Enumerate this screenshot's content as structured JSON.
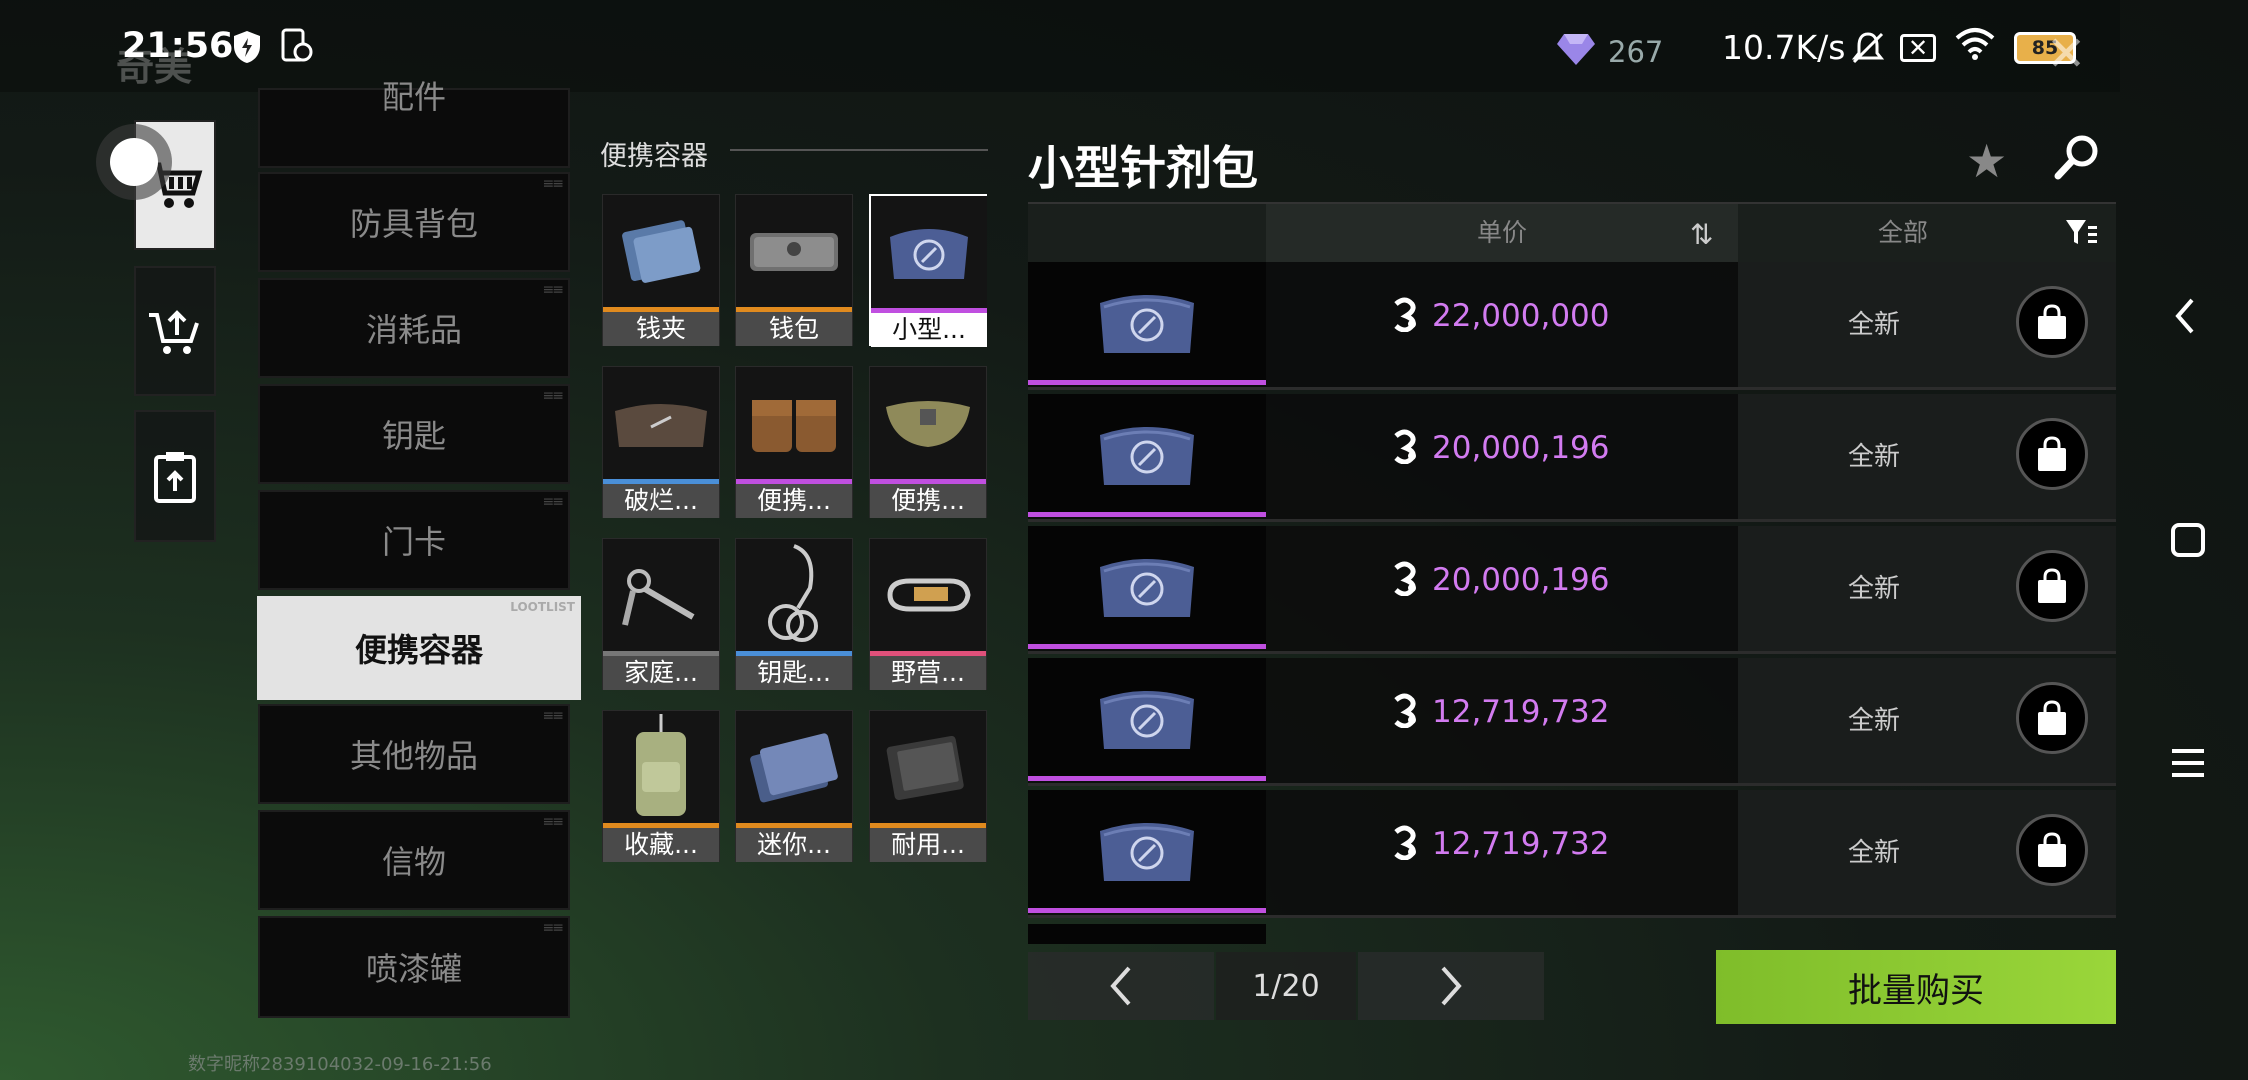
{
  "status_bar": {
    "time": "21:56",
    "gem_count": "267",
    "net_speed": "10.7K/s",
    "battery": "85"
  },
  "game_title": "奇美",
  "left_nav": [
    "market",
    "sell",
    "orders"
  ],
  "categories": {
    "partial_top": "配件",
    "items": [
      "防具背包",
      "消耗品",
      "钥匙",
      "门卡",
      "便携容器",
      "其他物品",
      "信物",
      "喷漆罐"
    ],
    "active": "便携容器",
    "active_tag": "LOOTLIST"
  },
  "grid": {
    "title": "便携容器",
    "items": [
      {
        "name": "钱夹",
        "rarity_color": "#e08a1e"
      },
      {
        "name": "钱包",
        "rarity_color": "#e08a1e"
      },
      {
        "name": "小型...",
        "rarity_color": "#c04fe0",
        "selected": true
      },
      {
        "name": "破烂...",
        "rarity_color": "#4a8fd8"
      },
      {
        "name": "便携...",
        "rarity_color": "#c04fe0"
      },
      {
        "name": "便携...",
        "rarity_color": "#c04fe0"
      },
      {
        "name": "家庭...",
        "rarity_color": "#777777"
      },
      {
        "name": "钥匙...",
        "rarity_color": "#4a8fd8"
      },
      {
        "name": "野营...",
        "rarity_color": "#e0507a"
      },
      {
        "name": "收藏...",
        "rarity_color": "#e08a1e"
      },
      {
        "name": "迷你...",
        "rarity_color": "#e08a1e"
      },
      {
        "name": "耐用...",
        "rarity_color": "#e08a1e"
      }
    ]
  },
  "panel": {
    "title": "小型针剂包",
    "header_price": "单价",
    "header_filter": "全部",
    "listings": [
      {
        "price": "22,000,000",
        "condition": "全新"
      },
      {
        "price": "20,000,196",
        "condition": "全新"
      },
      {
        "price": "20,000,196",
        "condition": "全新"
      },
      {
        "price": "12,719,732",
        "condition": "全新"
      },
      {
        "price": "12,719,732",
        "condition": "全新"
      }
    ],
    "page": "1/20",
    "bulk_buy": "批量购买"
  },
  "footer_id": "数字昵称2839104032-09-16-21:56",
  "colors": {
    "accent_green": "#8dc832",
    "price_purple": "#d27bf0"
  }
}
